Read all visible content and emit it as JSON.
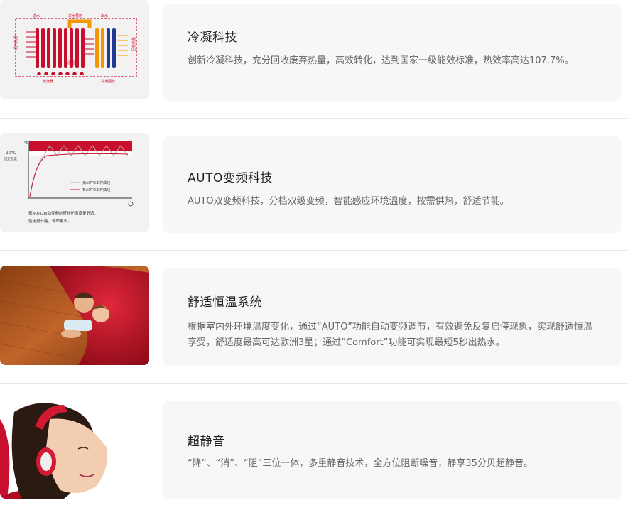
{
  "features": [
    {
      "title": "冷凝科技",
      "desc": "创新冷凝科技，充分回收废弃热量，高效转化，达到国家一级能效标准，热效率高达107.7%。",
      "image_labels": {
        "top_left": "进水",
        "top_mid": "进水预热",
        "top_right": "出水",
        "side_left": "烟气热量",
        "side_right": "回收热量",
        "bottom_left": "燃烧器",
        "bottom_mid": "低温烟气",
        "bottom_right": "冷凝回收"
      }
    },
    {
      "title": "AUTO变频科技",
      "desc": "AUTO双变频科技，分档双级变频，智能感应环境温度，按需供热，舒适节能。",
      "image_labels": {
        "temp": "20°C",
        "temp_sub": "恒定温度",
        "legend_without": "无AUTO工作曲线",
        "legend_with": "有AUTO工作曲线",
        "caption_line1": "有AUTO自动变频的壁挂炉温度更舒适、",
        "caption_line2": "使用更节能，寿命更长。"
      }
    },
    {
      "title": "舒适恒温系统",
      "desc": "根据室内外环境温度变化，通过“AUTO”功能自动变频调节，有效避免反复启停现象，实现舒适恒温享受，舒适度最高可达欧洲3星；通过”Comfort”功能可实现最短5秒出热水。"
    },
    {
      "title": "超静音",
      "desc": "“降”、“消”、“阻”三位一体，多重静音技术，全方位阻断噪音，静享35分贝超静音。"
    }
  ],
  "colors": {
    "card_bg": "#f7f7f7",
    "accent_red": "#c8102e",
    "accent_orange": "#f39800",
    "accent_blue": "#1f3a93",
    "divider": "#e6e6e6"
  }
}
